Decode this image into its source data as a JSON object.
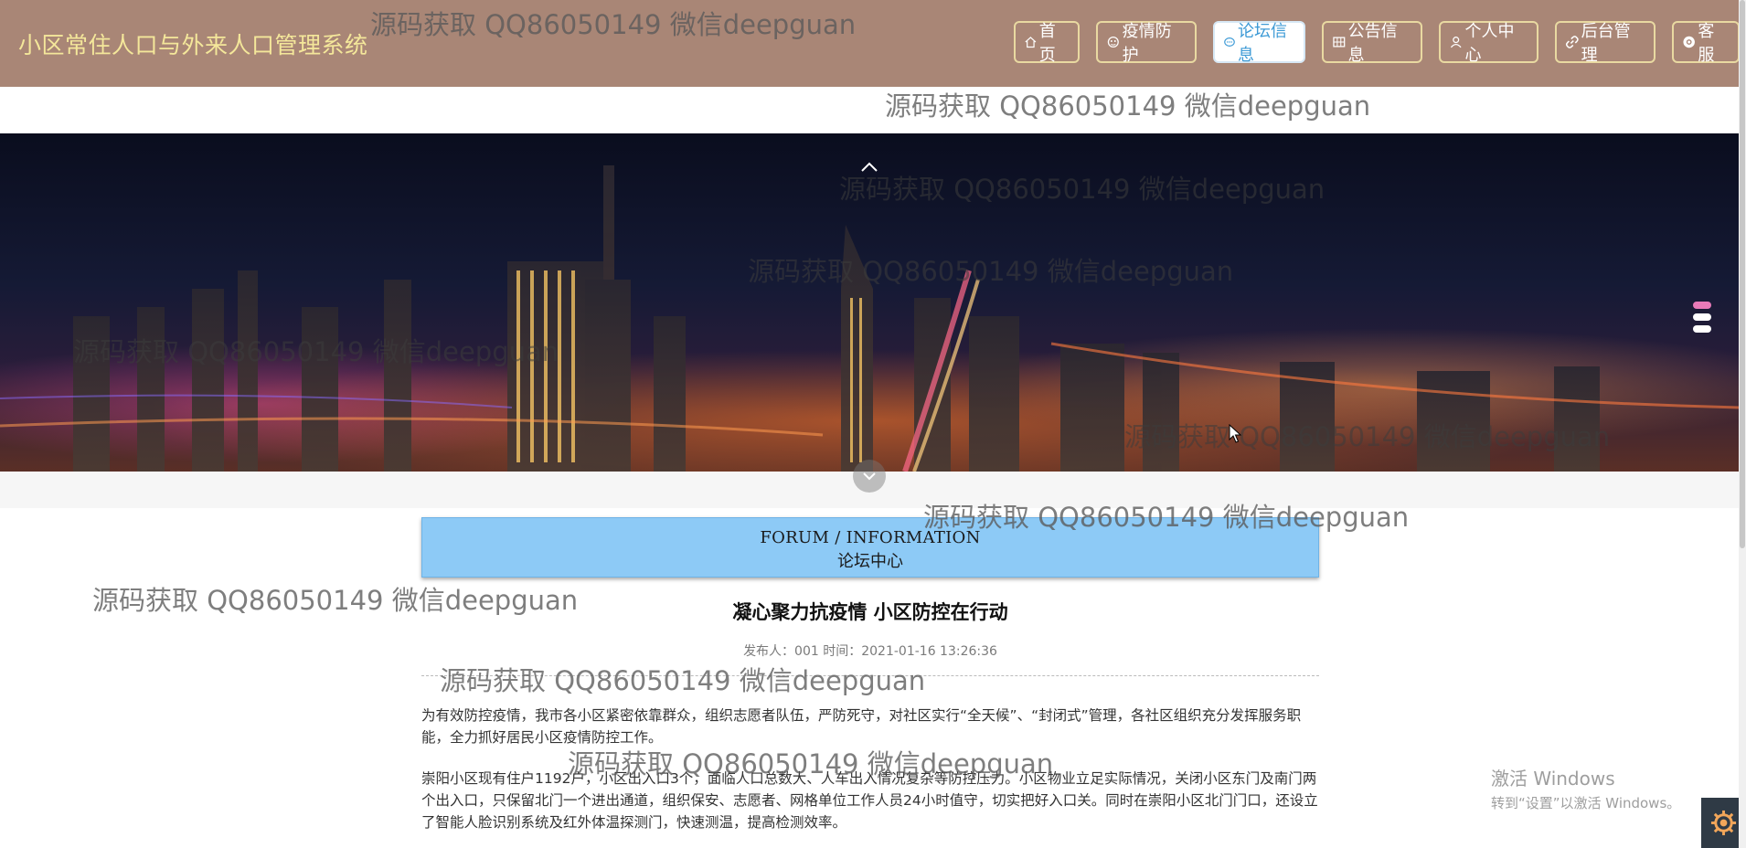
{
  "header": {
    "brand": "小区常住人口与外来人口管理系统",
    "nav": [
      {
        "icon": "home-icon",
        "label": "首页",
        "active": false
      },
      {
        "icon": "virus-icon",
        "label": "疫情防护",
        "active": false
      },
      {
        "icon": "chat-icon",
        "label": "论坛信息",
        "active": true
      },
      {
        "icon": "grid-icon",
        "label": "公告信息",
        "active": false
      },
      {
        "icon": "person-icon",
        "label": "个人中心",
        "active": false
      },
      {
        "icon": "link-icon",
        "label": "后台管理",
        "active": false
      },
      {
        "icon": "support-icon",
        "label": "客服",
        "active": false
      }
    ]
  },
  "banner": {
    "prev_icon": "chevron-up-icon",
    "next_icon": "chevron-down-icon",
    "slide_count": 3,
    "active_slide": 1
  },
  "forum": {
    "title_en": "FORUM / INFORMATION",
    "title_cn": "论坛中心"
  },
  "article": {
    "title": "凝心聚力抗疫情 小区防控在行动",
    "meta": "发布人：001 时间：2021-01-16 13:26:36",
    "paragraphs": [
      "为有效防控疫情，我市各小区紧密依靠群众，组织志愿者队伍，严防死守，对社区实行“全天候”、“封闭式”管理，各社区组织充分发挥服务职能，全力抓好居民小区疫情防控工作。",
      "崇阳小区现有住户1192户，小区出入口3个，面临人口总数大、人车出入情况复杂等防控压力。小区物业立足实际情况，关闭小区东门及南门两个出入口，只保留北门一个进出通道，组织保安、志愿者、网格单位工作人员24小时值守，切实把好入口关。同时在崇阳小区北门门口，还设立了智能人脸识别系统及红外体温探测门，快速测温，提高检测效率。"
    ]
  },
  "watermark": "源码获取 QQ86050149 微信deepguan",
  "windows_activation": {
    "line1": "激活 Windows",
    "line2": "转到“设置”以激活 Windows。"
  },
  "colors": {
    "header_bg": "#a98676",
    "brand_text": "#f4e79a",
    "title_box": "#8dcaf6",
    "active_nav_text": "#3d9ad6"
  }
}
